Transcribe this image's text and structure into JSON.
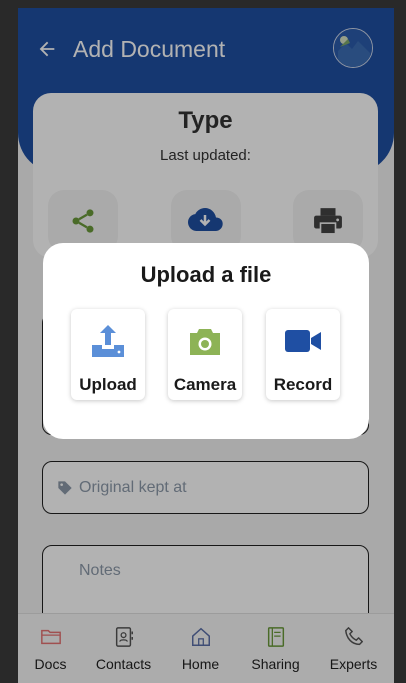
{
  "header": {
    "title": "Add Document"
  },
  "type_card": {
    "title": "Type",
    "last_updated_label": "Last updated:",
    "actions": [
      {
        "icon": "share-icon"
      },
      {
        "icon": "cloud-download-icon"
      },
      {
        "icon": "printer-icon"
      }
    ]
  },
  "form": {
    "original_kept_at_placeholder": "Original kept at",
    "notes_placeholder": "Notes"
  },
  "modal": {
    "title": "Upload a file",
    "options": [
      {
        "label": "Upload",
        "icon": "upload-icon",
        "color": "#5b8fd8"
      },
      {
        "label": "Camera",
        "icon": "camera-icon",
        "color": "#8db356"
      },
      {
        "label": "Record",
        "icon": "video-camera-icon",
        "color": "#1f4fa3"
      }
    ]
  },
  "bottom_nav": {
    "items": [
      {
        "label": "Docs",
        "icon": "folder-icon",
        "color": "#e57373"
      },
      {
        "label": "Contacts",
        "icon": "contacts-icon",
        "color": "#555555"
      },
      {
        "label": "Home",
        "icon": "home-icon",
        "color": "#5b6fa8"
      },
      {
        "label": "Sharing",
        "icon": "book-icon",
        "color": "#6a9a3a"
      },
      {
        "label": "Experts",
        "icon": "phone-icon",
        "color": "#555555"
      }
    ]
  },
  "colors": {
    "header_blue": "#1f4fa3",
    "share_green": "#6a9a3a",
    "download_blue": "#1f4fa3",
    "print_grey": "#444444"
  }
}
